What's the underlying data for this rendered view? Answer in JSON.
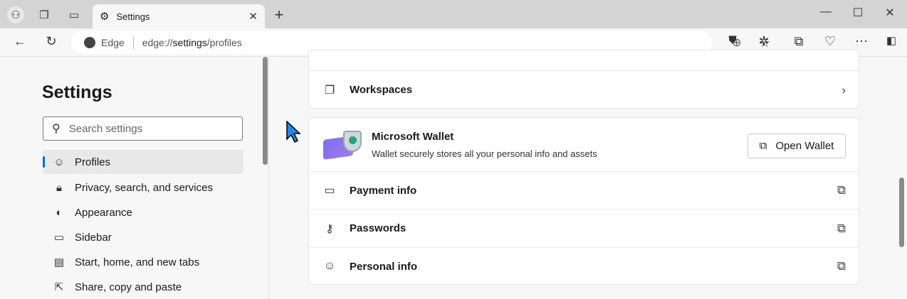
{
  "browser": {
    "tab_title": "Settings",
    "address_brand": "Edge",
    "url_prefix": "edge://",
    "url_bold": "settings",
    "url_suffix": "/profiles"
  },
  "sidebar": {
    "title": "Settings",
    "search_placeholder": "Search settings",
    "items": [
      {
        "label": "Profiles",
        "icon": "profile-icon",
        "selected": true
      },
      {
        "label": "Privacy, search, and services",
        "icon": "lock-icon"
      },
      {
        "label": "Appearance",
        "icon": "palette-icon"
      },
      {
        "label": "Sidebar",
        "icon": "sidebar-icon"
      },
      {
        "label": "Start, home, and new tabs",
        "icon": "home-icon"
      },
      {
        "label": "Share, copy and paste",
        "icon": "share-icon"
      }
    ]
  },
  "main": {
    "workspaces": "Workspaces",
    "wallet": {
      "title": "Microsoft Wallet",
      "description": "Wallet securely stores all your personal info and assets",
      "button": "Open Wallet"
    },
    "rows": [
      {
        "label": "Payment info"
      },
      {
        "label": "Passwords"
      },
      {
        "label": "Personal info"
      }
    ]
  }
}
